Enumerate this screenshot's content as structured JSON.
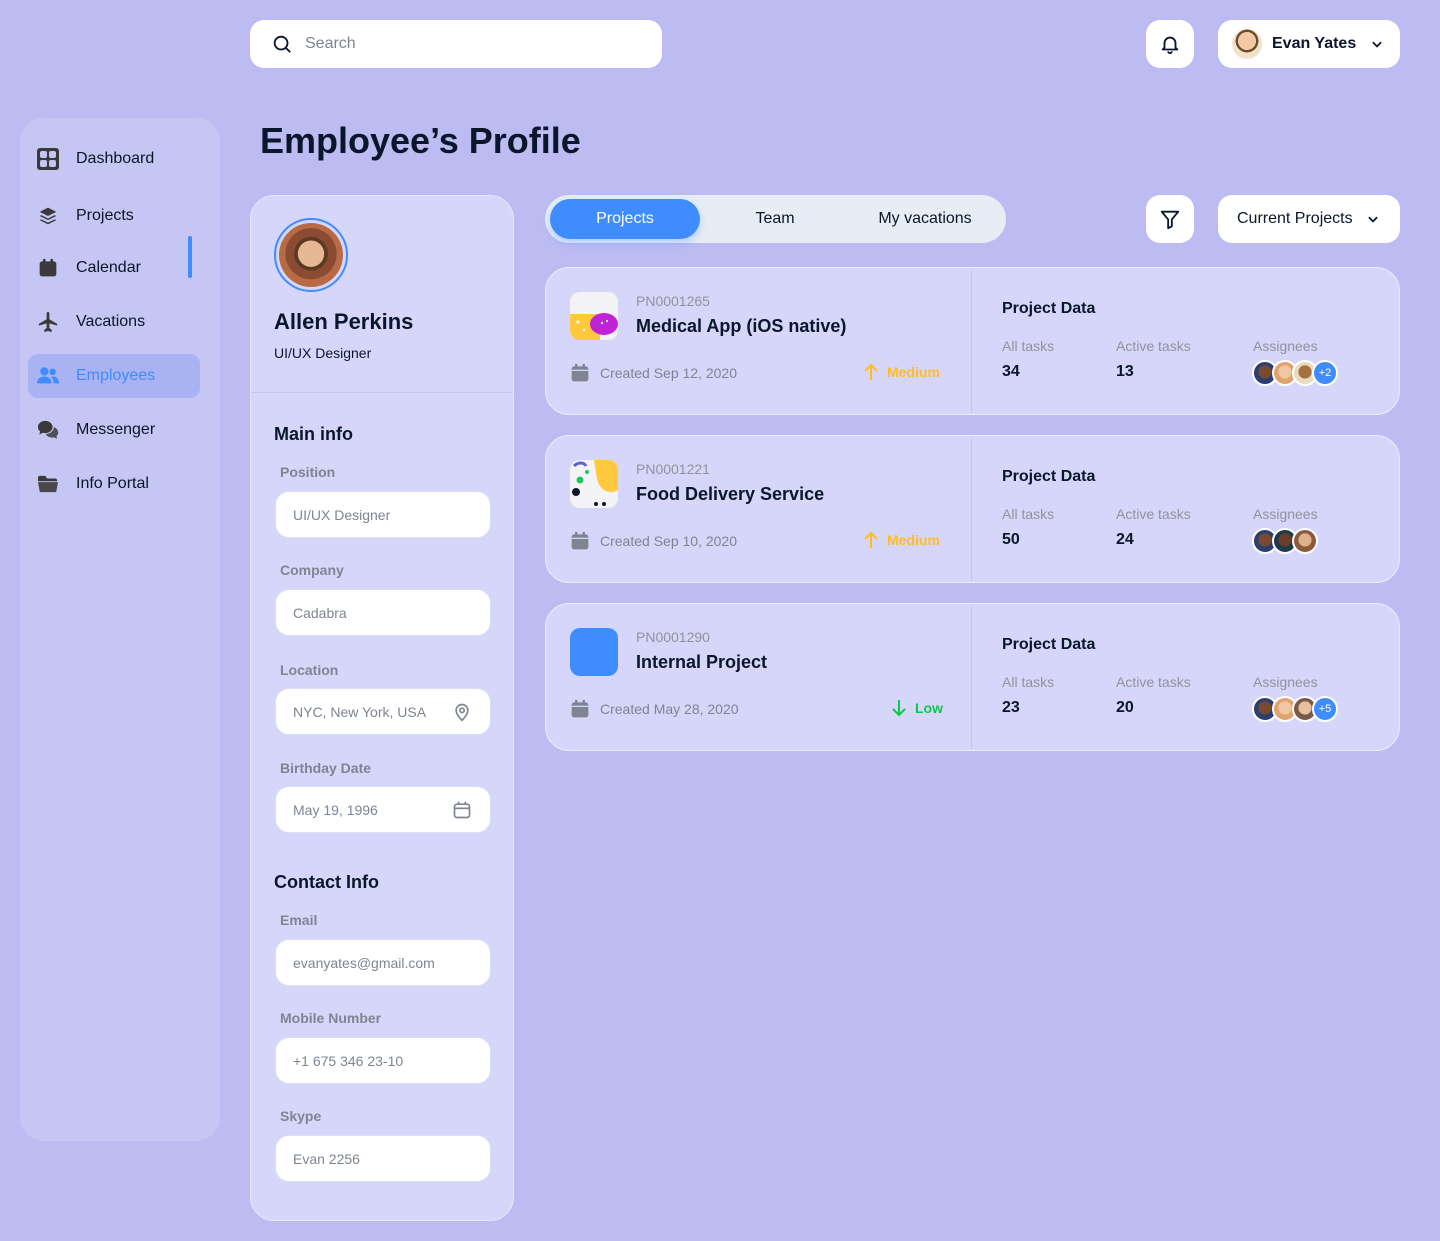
{
  "header": {
    "search_placeholder": "Search",
    "user_name": "Evan Yates"
  },
  "sidebar": {
    "items": [
      {
        "label": "Dashboard",
        "icon": "dashboard-icon"
      },
      {
        "label": "Projects",
        "icon": "layers-icon"
      },
      {
        "label": "Calendar",
        "icon": "calendar-icon"
      },
      {
        "label": "Vacations",
        "icon": "airplane-icon"
      },
      {
        "label": "Employees",
        "icon": "users-icon",
        "active": true
      },
      {
        "label": "Messenger",
        "icon": "chat-icon"
      },
      {
        "label": "Info Portal",
        "icon": "folder-icon"
      }
    ]
  },
  "page": {
    "title": "Employee’s Profile"
  },
  "profile": {
    "name": "Allen Perkins",
    "role": "UI/UX Designer",
    "main_info_title": "Main info",
    "position_label": "Position",
    "position_value": "UI/UX Designer",
    "company_label": "Company",
    "company_value": "Cadabra",
    "location_label": "Location",
    "location_value": "NYC, New York, USA",
    "birthday_label": "Birthday Date",
    "birthday_value": "May 19, 1996",
    "contact_title": "Contact Info",
    "email_label": "Email",
    "email_value": "evanyates@gmail.com",
    "mobile_label": "Mobile Number",
    "mobile_value": "+1 675 346 23-10",
    "skype_label": "Skype",
    "skype_value": "Evan 2256"
  },
  "tabs": [
    "Projects",
    "Team",
    "My vacations"
  ],
  "filter_select": "Current Projects",
  "projects": [
    {
      "code": "PN0001265",
      "name": "Medical App (iOS native)",
      "created": "Created Sep 12, 2020",
      "priority": "Medium",
      "priority_color": "#ffbd21",
      "data_title": "Project Data",
      "all_tasks_label": "All tasks",
      "all_tasks": "34",
      "active_tasks_label": "Active tasks",
      "active_tasks": "13",
      "assignees_label": "Assignees",
      "extra_assignees": "+2"
    },
    {
      "code": "PN0001221",
      "name": "Food Delivery Service",
      "created": "Created Sep 10, 2020",
      "priority": "Medium",
      "priority_color": "#ffbd21",
      "data_title": "Project Data",
      "all_tasks_label": "All tasks",
      "all_tasks": "50",
      "active_tasks_label": "Active tasks",
      "active_tasks": "24",
      "assignees_label": "Assignees",
      "extra_assignees": ""
    },
    {
      "code": "PN0001290",
      "name": "Internal Project",
      "created": "Created May 28, 2020",
      "priority": "Low",
      "priority_color": "#0ac947",
      "data_title": "Project Data",
      "all_tasks_label": "All tasks",
      "all_tasks": "23",
      "active_tasks_label": "Active tasks",
      "active_tasks": "20",
      "assignees_label": "Assignees",
      "extra_assignees": "+5"
    }
  ],
  "colors": {
    "accent": "#3f8cff",
    "background": "#bcbcf2",
    "medium": "#ffbd21",
    "low": "#0ac947"
  }
}
